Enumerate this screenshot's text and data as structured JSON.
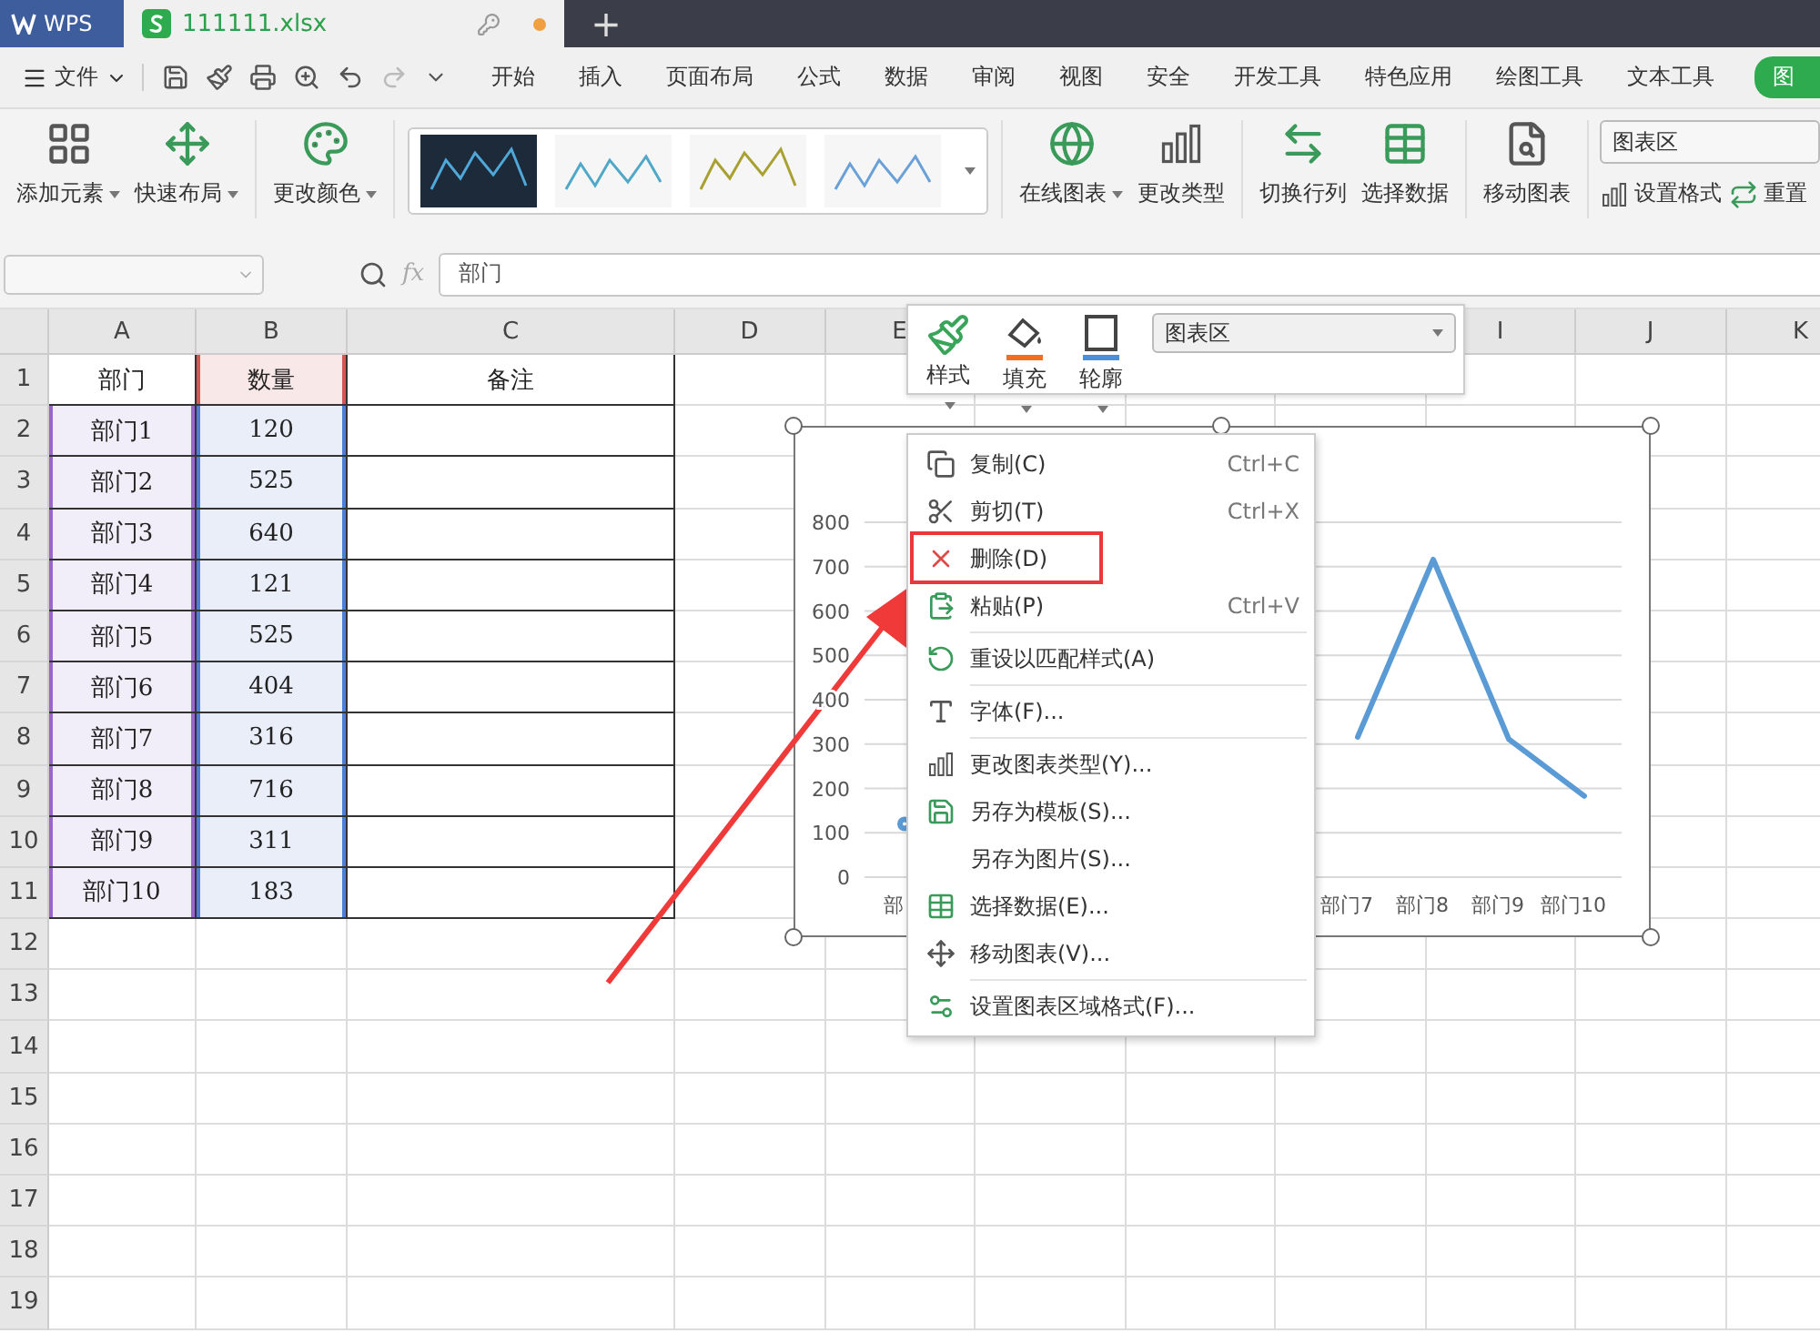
{
  "title_bar": {
    "app": "WPS",
    "tabs": [
      {
        "label": "111111.xlsx",
        "selected": true,
        "unsaved": true
      }
    ],
    "new_tab": "+"
  },
  "menu_bar": {
    "file_menu": "文件",
    "tabs": [
      {
        "label": "开始",
        "selected": false
      },
      {
        "label": "插入",
        "selected": false
      },
      {
        "label": "页面布局",
        "selected": false
      },
      {
        "label": "公式",
        "selected": false
      },
      {
        "label": "数据",
        "selected": false
      },
      {
        "label": "审阅",
        "selected": false
      },
      {
        "label": "视图",
        "selected": false
      },
      {
        "label": "安全",
        "selected": false
      },
      {
        "label": "开发工具",
        "selected": false
      },
      {
        "label": "特色应用",
        "selected": false
      },
      {
        "label": "绘图工具",
        "selected": false
      },
      {
        "label": "文本工具",
        "selected": false
      },
      {
        "label": "图",
        "selected": true
      }
    ]
  },
  "ribbon": {
    "groups": [
      {
        "buttons": [
          {
            "label": "添加元素",
            "dropdown": true
          },
          {
            "label": "快速布局",
            "dropdown": true
          }
        ]
      },
      {
        "buttons": [
          {
            "label": "更改颜色",
            "dropdown": true
          }
        ]
      },
      {
        "kind": "gallery"
      },
      {
        "buttons": [
          {
            "label": "在线图表",
            "dropdown": true
          },
          {
            "label": "更改类型",
            "dropdown": false
          }
        ]
      },
      {
        "buttons": [
          {
            "label": "切换行列",
            "dropdown": false
          },
          {
            "label": "选择数据",
            "dropdown": false
          }
        ]
      },
      {
        "buttons": [
          {
            "label": "移动图表",
            "dropdown": false
          }
        ]
      }
    ],
    "element_select": "图表区",
    "small_buttons": [
      {
        "label": "设置格式"
      },
      {
        "label": "重置"
      }
    ]
  },
  "formula_bar": {
    "fx": "fx",
    "value": "部门"
  },
  "sheet": {
    "columns": [
      "A",
      "B",
      "C",
      "D",
      "E"
    ],
    "columns_right": [
      "I",
      "J",
      "K"
    ],
    "rows": [
      {
        "number": "1",
        "cells": [
          {
            "text": "部门"
          },
          {
            "text": "数量",
            "kind": "header"
          },
          {
            "text": "备注"
          }
        ]
      },
      {
        "number": "2",
        "cells": [
          {
            "text": "部门1",
            "kind": "category"
          },
          {
            "text": "120",
            "kind": "value"
          }
        ]
      },
      {
        "number": "3",
        "cells": [
          {
            "text": "部门2",
            "kind": "category"
          },
          {
            "text": "525",
            "kind": "value"
          }
        ]
      },
      {
        "number": "4",
        "cells": [
          {
            "text": "部门3",
            "kind": "category"
          },
          {
            "text": "640",
            "kind": "value"
          }
        ]
      },
      {
        "number": "5",
        "cells": [
          {
            "text": "部门4",
            "kind": "category"
          },
          {
            "text": "121",
            "kind": "value"
          }
        ]
      },
      {
        "number": "6",
        "cells": [
          {
            "text": "部门5",
            "kind": "category"
          },
          {
            "text": "525",
            "kind": "value"
          }
        ]
      },
      {
        "number": "7",
        "cells": [
          {
            "text": "部门6",
            "kind": "category"
          },
          {
            "text": "404",
            "kind": "value"
          }
        ]
      },
      {
        "number": "8",
        "cells": [
          {
            "text": "部门7",
            "kind": "category"
          },
          {
            "text": "316",
            "kind": "value"
          }
        ]
      },
      {
        "number": "9",
        "cells": [
          {
            "text": "部门8",
            "kind": "category"
          },
          {
            "text": "716",
            "kind": "value"
          }
        ]
      },
      {
        "number": "10",
        "cells": [
          {
            "text": "部门9",
            "kind": "category"
          },
          {
            "text": "311",
            "kind": "value"
          }
        ]
      },
      {
        "number": "11",
        "cells": [
          {
            "text": "部门10",
            "kind": "category"
          },
          {
            "text": "183",
            "kind": "value"
          }
        ]
      },
      {
        "number": "12"
      },
      {
        "number": "13"
      },
      {
        "number": "14"
      },
      {
        "number": "15"
      },
      {
        "number": "16"
      },
      {
        "number": "17"
      },
      {
        "number": "18"
      },
      {
        "number": "19"
      }
    ]
  },
  "chart": {
    "chart_data": {
      "type": "line",
      "categories": [
        "部",
        null,
        null,
        null,
        null,
        null,
        "部门7",
        "部门8",
        "部门9",
        "部门10"
      ],
      "series": [
        {
          "color": "#5b9bd5",
          "values": [
            120,
            null,
            null,
            null,
            null,
            null,
            316,
            716,
            311,
            183
          ]
        }
      ],
      "ylim": [
        0,
        800
      ],
      "yticks": [
        0,
        100,
        200,
        300,
        400,
        500,
        600,
        700,
        800
      ],
      "grid": true
    }
  },
  "mini_toolbar": {
    "buttons": [
      {
        "label": "样式"
      },
      {
        "label": "填充"
      },
      {
        "label": "轮廓"
      }
    ],
    "element_select": "图表区"
  },
  "context_menu": {
    "items": [
      {
        "label": "复制(C)",
        "shortcut": "Ctrl+C",
        "highlighted": false,
        "separator_after": false
      },
      {
        "label": "剪切(T)",
        "shortcut": "Ctrl+X",
        "highlighted": false,
        "separator_after": false
      },
      {
        "label": "删除(D)",
        "highlighted": true,
        "separator_after": false
      },
      {
        "label": "粘贴(P)",
        "shortcut": "Ctrl+V",
        "highlighted": false,
        "separator_after": true
      },
      {
        "label": "重设以匹配样式(A)",
        "highlighted": false,
        "separator_after": true
      },
      {
        "label": "字体(F)...",
        "highlighted": false,
        "separator_after": true
      },
      {
        "label": "更改图表类型(Y)...",
        "highlighted": false,
        "separator_after": false
      },
      {
        "label": "另存为模板(S)...",
        "highlighted": false,
        "separator_after": false
      },
      {
        "label": "另存为图片(S)...",
        "highlighted": false,
        "separator_after": false
      },
      {
        "label": "选择数据(E)...",
        "highlighted": false,
        "separator_after": false
      },
      {
        "label": "移动图表(V)...",
        "highlighted": false,
        "separator_after": true
      },
      {
        "label": "设置图表区域格式(F)...",
        "highlighted": false,
        "separator_after": false
      }
    ]
  }
}
